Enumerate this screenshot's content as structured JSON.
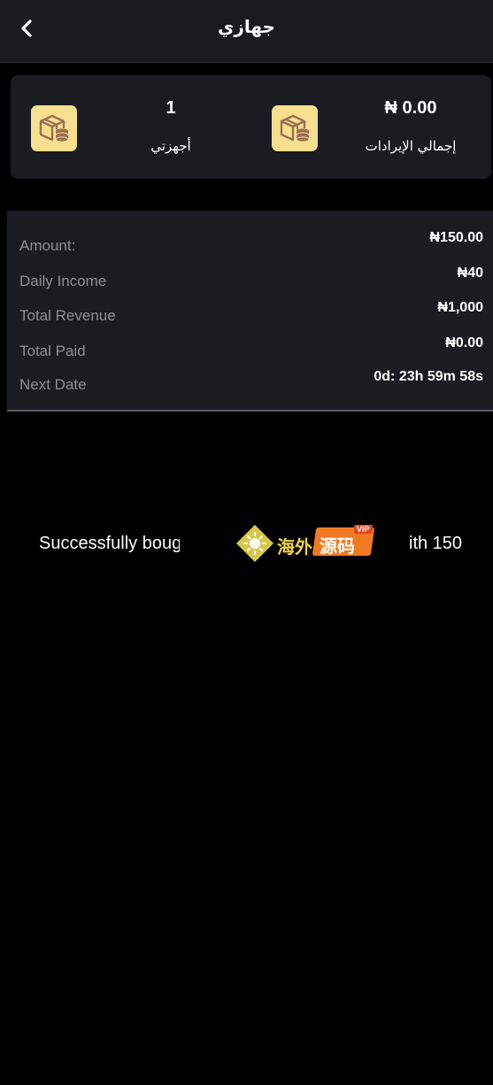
{
  "header": {
    "title": "جهازي",
    "back_icon": "chevron-left-icon"
  },
  "summary": {
    "left": {
      "value": "1",
      "label": "أجهزتي",
      "icon": "box-coins-icon"
    },
    "right": {
      "value": "₦ 0.00",
      "label": "إجمالي الإيرادات",
      "icon": "box-coins-icon"
    },
    "icon_bg": "#f6df8e",
    "icon_color": "#9a6f55"
  },
  "details": {
    "rows": [
      {
        "label": "Amount:",
        "value": "₦150.00"
      },
      {
        "label": "Daily Income",
        "value": "₦40"
      },
      {
        "label": "Total Revenue",
        "value": "₦1,000"
      },
      {
        "label": "Total Paid",
        "value": "₦0.00"
      },
      {
        "label": "Next Date",
        "value": "0d: 23h 59m 58s"
      }
    ]
  },
  "toast": {
    "text_left": "Successfully boug",
    "text_right": "ith 150"
  },
  "watermark": {
    "text1": "海外",
    "text2": "源码",
    "badge": "VIP"
  },
  "colors": {
    "background": "#000000",
    "card": "#1b1c21",
    "muted_text": "#8e8f94"
  }
}
